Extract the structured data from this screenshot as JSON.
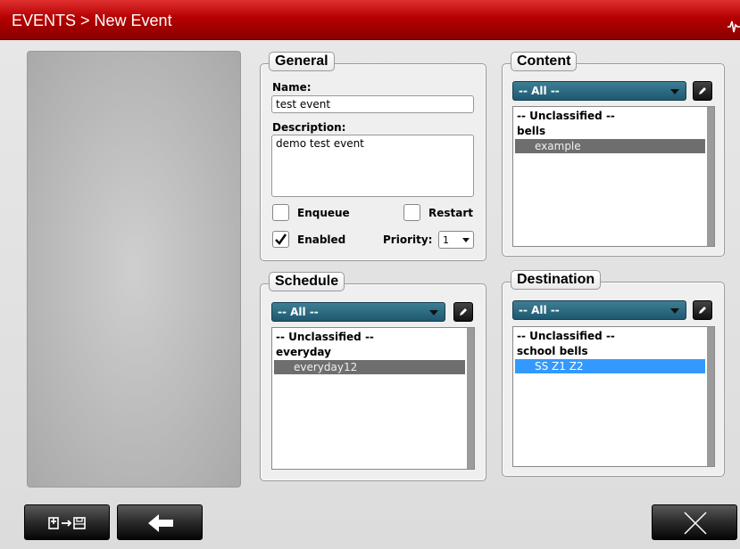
{
  "header": {
    "title": "EVENTS > New Event"
  },
  "general": {
    "legend": "General",
    "name_label": "Name:",
    "name_value": "test event",
    "description_label": "Description:",
    "description_value": "demo test event",
    "enqueue_label": "Enqueue",
    "enqueue_checked": false,
    "restart_label": "Restart",
    "restart_checked": false,
    "enabled_label": "Enabled",
    "enabled_checked": true,
    "priority_label": "Priority:",
    "priority_value": "1"
  },
  "content": {
    "legend": "Content",
    "filter": "-- All --",
    "items": [
      {
        "label": "-- Unclassified --",
        "kind": "cat"
      },
      {
        "label": "bells",
        "kind": "cat"
      },
      {
        "label": "example",
        "kind": "child",
        "selected": true
      }
    ]
  },
  "schedule": {
    "legend": "Schedule",
    "filter": "-- All --",
    "items": [
      {
        "label": "-- Unclassified --",
        "kind": "cat"
      },
      {
        "label": "everyday",
        "kind": "cat"
      },
      {
        "label": "everyday12",
        "kind": "child",
        "selected": true
      }
    ]
  },
  "destination": {
    "legend": "Destination",
    "filter": "-- All --",
    "items": [
      {
        "label": "-- Unclassified --",
        "kind": "cat"
      },
      {
        "label": "school bells",
        "kind": "cat"
      },
      {
        "label": "SS Z1 Z2",
        "kind": "child",
        "selected": true
      }
    ]
  },
  "colors": {
    "header_red": "#b40000",
    "dropdown_teal": "#2a6a82",
    "selection_gray": "#6e6e6e",
    "selection_blue": "#3399ff"
  },
  "icons": {
    "save": "save-to-disk-icon",
    "back": "back-arrow-icon",
    "cancel": "close-icon",
    "edit": "pencil-icon",
    "status": "heartbeat-wave-icon"
  }
}
